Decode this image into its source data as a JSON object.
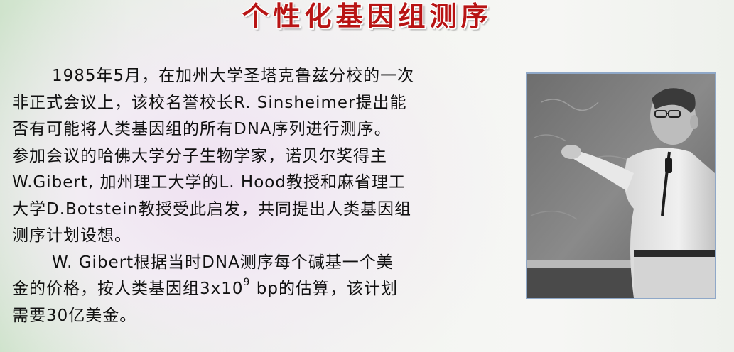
{
  "slide": {
    "title": "个性化基因组测序"
  },
  "paragraph1": {
    "line1": "1985年5月，在加州大学圣塔克鲁兹分校的一次",
    "line2": "非正式会议上，该校名誉校长R. Sinsheimer提出能",
    "line3": "否有可能将人类基因组的所有DNA序列进行测序。",
    "line4": "参加会议的哈佛大学分子生物学家，诺贝尔奖得主",
    "line5": "W.Gibert, 加州理工大学的L. Hood教授和麻省理工",
    "line6": "大学D.Botstein教授受此启发，共同提出人类基因组",
    "line7": "测序计划设想。"
  },
  "paragraph2": {
    "line1": "W. Gibert根据当时DNA测序每个碱基一个美",
    "line2_before": "金的价格，按人类基因组3x10",
    "line2_exp": "9",
    "line2_after": " bp的估算，该计划",
    "line3": "需要30亿美金。"
  },
  "photo": {
    "subject": "man-writing-on-chalkboard-photo"
  }
}
